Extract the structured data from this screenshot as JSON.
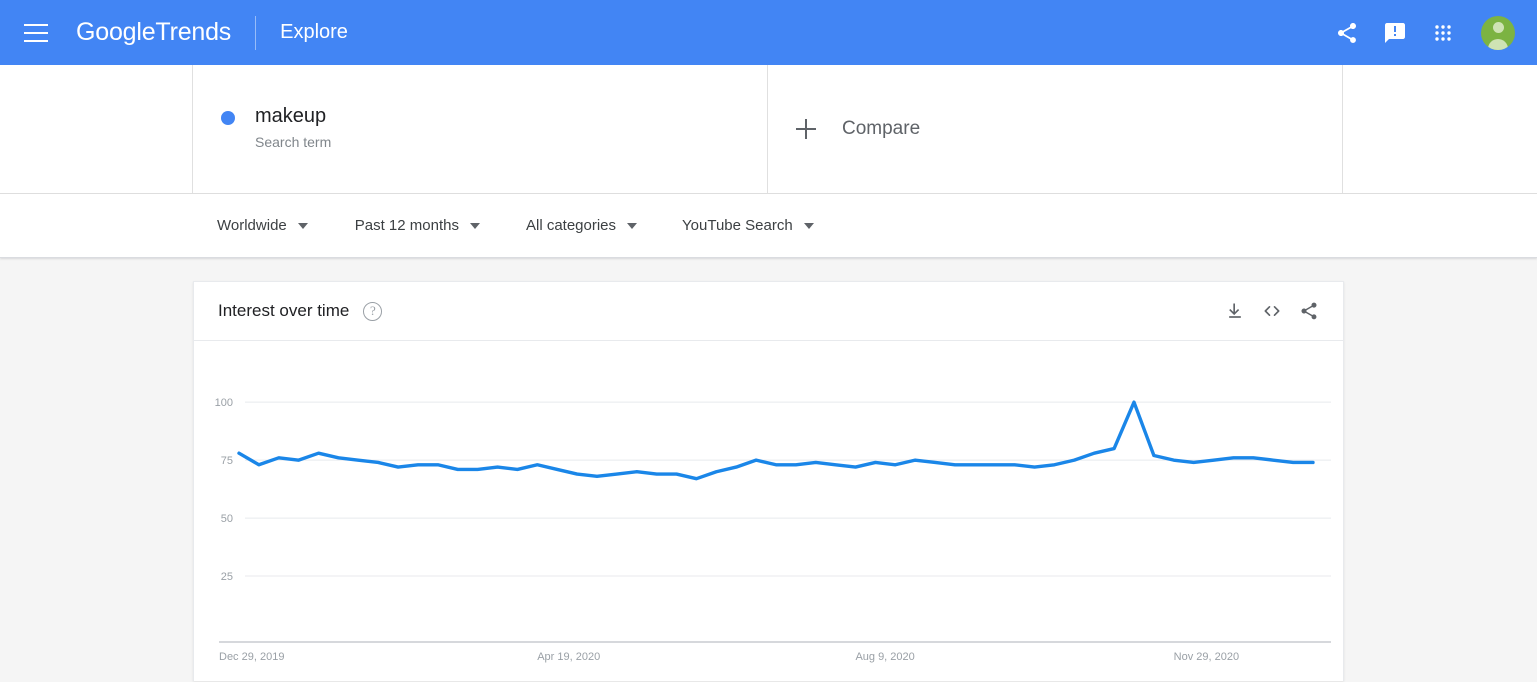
{
  "appbar": {
    "brand_bold": "Google",
    "brand_light": "Trends",
    "explore_label": "Explore",
    "menu_icon": "hamburger-menu-icon",
    "share_icon": "share-icon",
    "feedback_icon": "feedback-icon",
    "apps_icon": "apps-grid-icon",
    "avatar_icon": "account-avatar",
    "background_color": "#4285f4"
  },
  "terms": {
    "items": [
      {
        "name": "makeup",
        "subtitle": "Search term",
        "dot_color": "#4285f4"
      }
    ],
    "compare_label": "Compare",
    "compare_icon": "plus-icon"
  },
  "filters": [
    {
      "label": "Worldwide",
      "name": "filter-location"
    },
    {
      "label": "Past 12 months",
      "name": "filter-time-range"
    },
    {
      "label": "All categories",
      "name": "filter-category"
    },
    {
      "label": "YouTube Search",
      "name": "filter-search-type"
    }
  ],
  "card": {
    "title": "Interest over time",
    "help_icon": "help-circle-icon",
    "help_glyph": "?",
    "actions": [
      {
        "name": "download-csv-button",
        "icon": "download-icon"
      },
      {
        "name": "embed-button",
        "icon": "embed-code-icon",
        "glyph": "<>"
      },
      {
        "name": "share-chart-button",
        "icon": "share-icon"
      }
    ]
  },
  "chart_data": {
    "type": "line",
    "title": "Interest over time",
    "xlabel": "",
    "ylabel": "",
    "ylim": [
      0,
      110
    ],
    "yticks": [
      25,
      50,
      75,
      100
    ],
    "ytick_labels": [
      "25",
      "50",
      "75",
      "100"
    ],
    "grid": true,
    "legend": false,
    "line_color": "#1a86e8",
    "x_tick_labels": [
      "Dec 29, 2019",
      "Apr 19, 2020",
      "Aug 9, 2020",
      "Nov 29, 2020"
    ],
    "x_tick_indices": [
      0,
      16,
      32,
      48
    ],
    "series": [
      {
        "name": "makeup",
        "color": "#1a86e8",
        "values": [
          78,
          73,
          76,
          75,
          78,
          76,
          75,
          74,
          72,
          73,
          73,
          71,
          71,
          72,
          71,
          73,
          71,
          69,
          68,
          69,
          70,
          69,
          69,
          67,
          70,
          72,
          75,
          73,
          73,
          74,
          73,
          72,
          74,
          73,
          75,
          74,
          73,
          73,
          73,
          73,
          72,
          73,
          75,
          78,
          80,
          100,
          77,
          75,
          74,
          75,
          76,
          76,
          75,
          74,
          74
        ]
      }
    ]
  }
}
